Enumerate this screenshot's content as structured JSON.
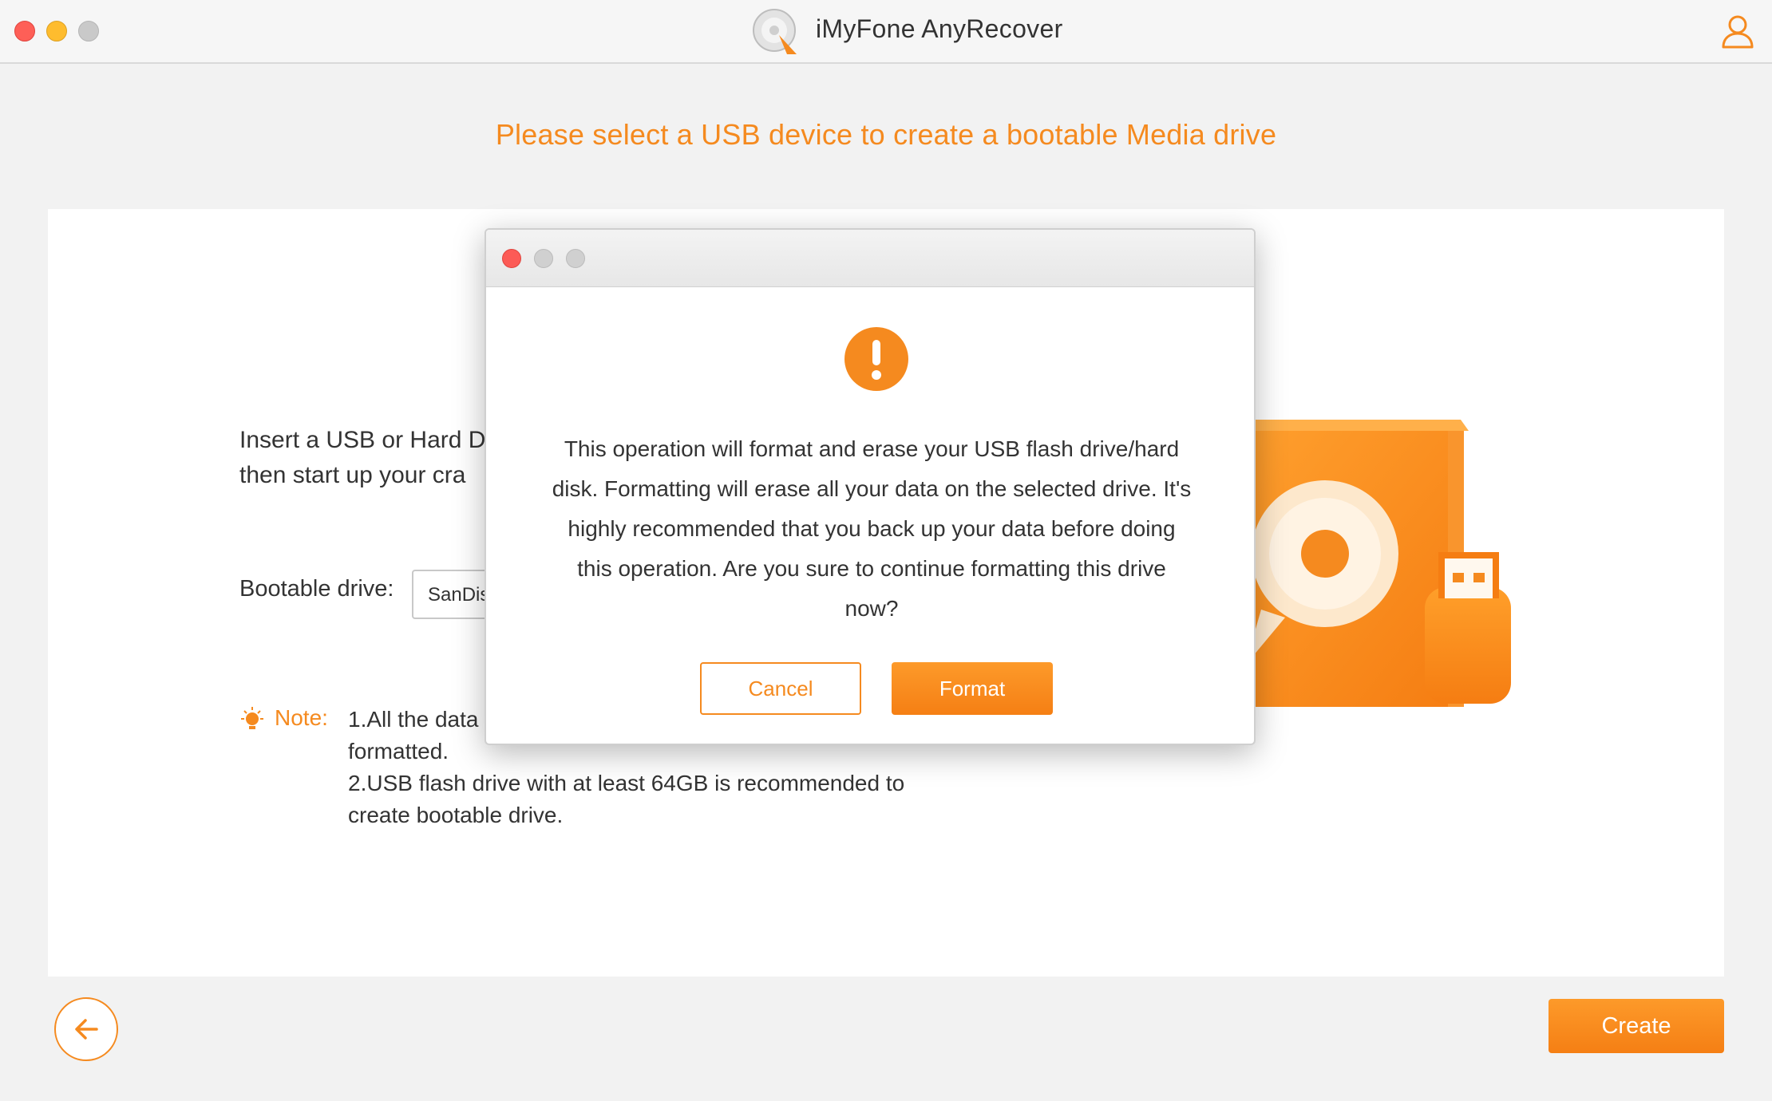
{
  "window": {
    "title": "iMyFone AnyRecover",
    "logo_icon": "disc-logo-icon",
    "account_icon": "user-icon"
  },
  "heading": "Please select a USB device to create a bootable Media drive",
  "instructions": {
    "line1": "Insert a USB or Hard D",
    "line2": "then start up your cra"
  },
  "bootable": {
    "label": "Bootable drive:",
    "selected_value": "SanDis"
  },
  "note": {
    "label": "Note:",
    "line1": "1.All the data",
    "line2": "formatted.",
    "line3": "2.USB flash drive with at least 64GB is recommended to",
    "line4": "create bootable drive."
  },
  "dialog": {
    "message": "This operation will format and erase your USB flash drive/hard disk. Formatting will erase all your data on the selected drive. It's highly recommended that you back up your data before doing this operation. Are you sure to continue formatting this drive now?",
    "cancel_label": "Cancel",
    "format_label": "Format"
  },
  "footer": {
    "create_label": "Create"
  },
  "colors": {
    "accent": "#f58a1f",
    "background": "#f2f2f2",
    "panel": "#ffffff"
  }
}
